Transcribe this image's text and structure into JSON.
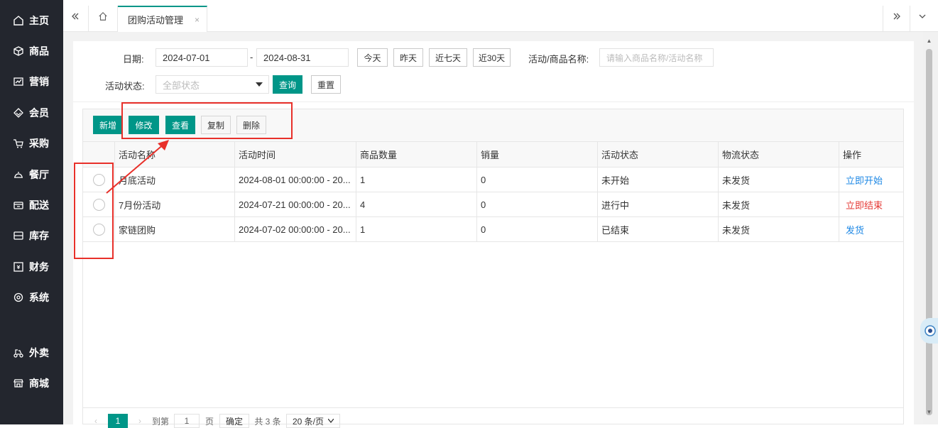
{
  "sidebar": {
    "items": [
      {
        "label": "主页",
        "icon": "home-icon"
      },
      {
        "label": "商品",
        "icon": "box-icon"
      },
      {
        "label": "营销",
        "icon": "chart-icon"
      },
      {
        "label": "会员",
        "icon": "diamond-icon"
      },
      {
        "label": "采购",
        "icon": "cart-icon"
      },
      {
        "label": "餐厅",
        "icon": "cloche-icon"
      },
      {
        "label": "配送",
        "icon": "delivery-icon"
      },
      {
        "label": "库存",
        "icon": "inventory-icon"
      },
      {
        "label": "财务",
        "icon": "finance-icon"
      },
      {
        "label": "系统",
        "icon": "gear-icon"
      },
      {
        "label": "外卖",
        "icon": "scooter-icon"
      },
      {
        "label": "商城",
        "icon": "store-icon"
      }
    ]
  },
  "tabs": {
    "active": "团购活动管理",
    "close": "×"
  },
  "filters": {
    "date_label": "日期:",
    "date_from": "2024-07-01",
    "date_sep": "-",
    "date_to": "2024-08-31",
    "quick": [
      "今天",
      "昨天",
      "近七天",
      "近30天"
    ],
    "name_label": "活动/商品名称:",
    "name_placeholder": "请输入商品名称/活动名称",
    "status_label": "活动状态:",
    "status_value": "全部状态",
    "query_label": "查询",
    "reset_label": "重置"
  },
  "toolbar": {
    "add": "新增",
    "edit": "修改",
    "view": "查看",
    "copy": "复制",
    "delete": "删除"
  },
  "table": {
    "columns": [
      "活动名称",
      "活动时间",
      "商品数量",
      "销量",
      "活动状态",
      "物流状态",
      "操作"
    ],
    "rows": [
      {
        "name": "月底活动",
        "time": "2024-08-01 00:00:00 - 20...",
        "qty": "1",
        "sales": "0",
        "status": "未开始",
        "logistics": "未发货",
        "action": "立即开始",
        "action_color": "#1e88e5"
      },
      {
        "name": "7月份活动",
        "time": "2024-07-21 00:00:00 - 20...",
        "qty": "4",
        "sales": "0",
        "status": "进行中",
        "logistics": "未发货",
        "action": "立即结束",
        "action_color": "#e53935"
      },
      {
        "name": "家链团购",
        "time": "2024-07-02 00:00:00 - 20...",
        "qty": "1",
        "sales": "0",
        "status": "已结束",
        "logistics": "未发货",
        "action": "发货",
        "action_color": "#1e88e5"
      }
    ]
  },
  "pager": {
    "prev": "‹",
    "current": "1",
    "next": "›",
    "goto_label": "到第",
    "goto_value": "1",
    "page_unit": "页",
    "confirm": "确定",
    "total": "共 3 条",
    "page_size": "20 条/页"
  },
  "colors": {
    "accent": "#009688",
    "sidebar_bg": "#23262e",
    "annotation": "#e8302a"
  }
}
